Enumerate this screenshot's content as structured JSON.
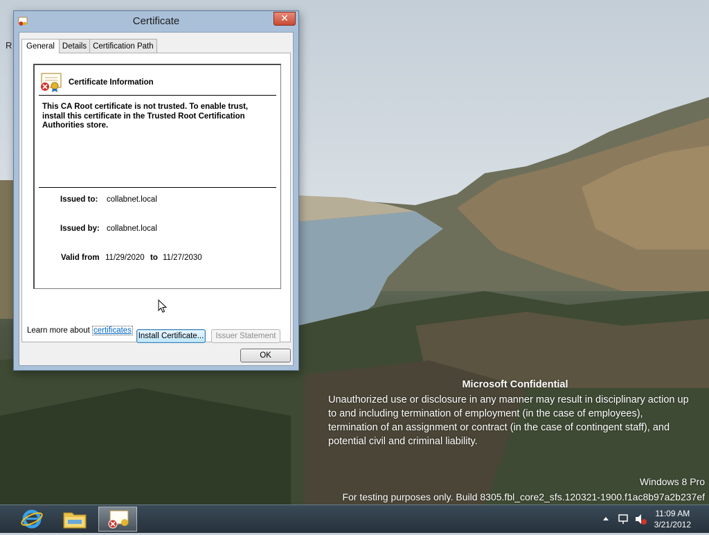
{
  "desktop": {
    "stray_text": "R",
    "confidential": {
      "title": "Microsoft Confidential",
      "line1": "Unauthorized use or disclosure in any manner may result in disciplinary action up",
      "line2": "to and including termination of employment (in the case of employees),",
      "line3": "termination of an assignment or contract (in the case of contingent staff), and",
      "line4": "potential civil and criminal liability."
    },
    "os_name": "Windows 8 Pro",
    "build": "For testing purposes only. Build 8305.fbl_core2_sfs.120321-1900.f1ac8b97a2b237ef"
  },
  "dialog": {
    "title": "Certificate",
    "close_glyph": "✕",
    "tabs": [
      {
        "label": "General",
        "active": true
      },
      {
        "label": "Details",
        "active": false
      },
      {
        "label": "Certification Path",
        "active": false
      }
    ],
    "info_heading": "Certificate Information",
    "warning_text": "This CA Root certificate is not trusted. To enable trust, install this certificate in the Trusted Root Certification Authorities store.",
    "issued_to_label": "Issued to:",
    "issued_to_value": "collabnet.local",
    "issued_by_label": "Issued by:",
    "issued_by_value": "collabnet.local",
    "valid_from_label": "Valid from",
    "valid_from_value": "11/29/2020",
    "valid_to_label": "to",
    "valid_to_value": "11/27/2030",
    "install_button": "Install Certificate...",
    "issuer_statement_button": "Issuer Statement",
    "learn_more_prefix": "Learn more about ",
    "learn_more_link": "certificates",
    "ok_button": "OK"
  },
  "taskbar": {
    "apps": [
      "internet-explorer",
      "file-explorer",
      "certificate"
    ],
    "clock_time": "11:09 AM",
    "clock_date": "3/21/2012"
  },
  "colors": {
    "dialog_frame": "#aac0d9",
    "link": "#0066cc",
    "close": "#c74a33"
  }
}
